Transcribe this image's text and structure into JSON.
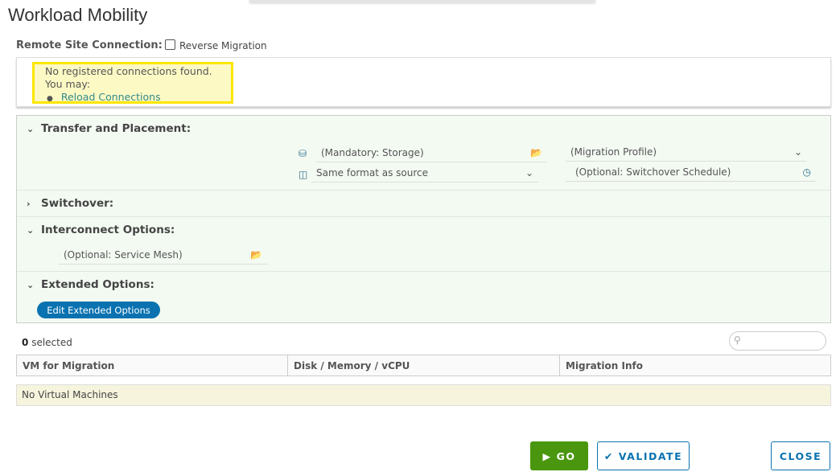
{
  "title": "Workload Mobility",
  "remote_site_label": "Remote Site Connection:",
  "reverse_migration_label": "Reverse Migration",
  "warning": {
    "line1": "No registered connections found.",
    "line2": "You may:",
    "link": "Reload Connections"
  },
  "sections": {
    "transfer": {
      "label": "Transfer and Placement:",
      "storage_placeholder": "(Mandatory: Storage)",
      "format_value": "Same format as source",
      "profile_placeholder": "(Migration Profile)",
      "schedule_placeholder": "(Optional: Switchover Schedule)"
    },
    "switchover": {
      "label": "Switchover:"
    },
    "interconnect": {
      "label": "Interconnect Options:",
      "mesh_placeholder": "(Optional: Service Mesh)"
    },
    "extended": {
      "label": "Extended Options:",
      "button": "Edit Extended Options"
    }
  },
  "selection": {
    "count": "0",
    "label": "selected"
  },
  "table": {
    "columns": [
      "VM for Migration",
      "Disk / Memory / vCPU",
      "Migration Info"
    ],
    "empty": "No Virtual Machines"
  },
  "buttons": {
    "go": "GO",
    "validate": "VALIDATE",
    "close": "CLOSE"
  }
}
